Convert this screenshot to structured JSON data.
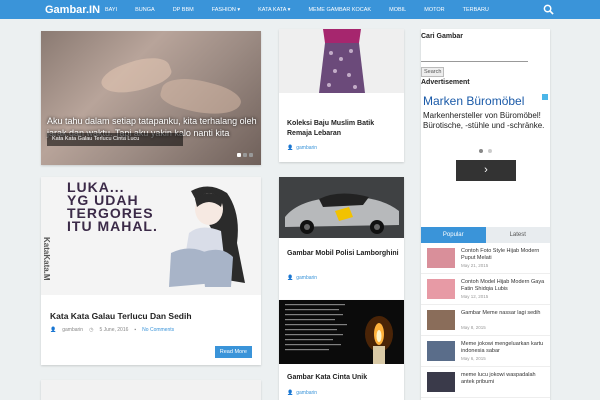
{
  "site": {
    "logo": "Gambar.IN"
  },
  "nav": [
    "BAYI",
    "BUNGA",
    "DP BBM",
    "FASHION ▾",
    "KATA KATA ▾",
    "MEME GAMBAR KOCAK",
    "MOBIL",
    "MOTOR",
    "TERBARU"
  ],
  "slider": {
    "quote": "Aku tahu dalam setiap tatapanku, kita terhalang oleh jarak dan waktu. Tapi aku yakin kalo nanti kita",
    "caption": "Kata Kata Galau Terlucu Cinta Lucu"
  },
  "post1": {
    "image_text": [
      "LUKA...",
      "YG UDAH",
      "TERGORES",
      "ITU MAHAL."
    ],
    "side_text": "KataKata.M",
    "title": "Kata Kata Galau Terlucu Dan Sedih",
    "author": "gambarin",
    "date": "5 June, 2016",
    "comments": "No Comments",
    "read_more": "Read More"
  },
  "mid": [
    {
      "title": "Koleksi Baju Muslim Batik Remaja Lebaran",
      "author": "gambarin"
    },
    {
      "title": "Gambar Mobil Polisi Lamborghini",
      "author": "gambarin"
    },
    {
      "title": "Gambar Kata Cinta Unik",
      "author": "gambarin"
    }
  ],
  "sidebar": {
    "search_heading": "Cari Gambar",
    "search_button": "Search",
    "ad_heading": "Advertisement",
    "ad_brand": "Marken Büromöbel",
    "ad_body": "Markenhersteller von Büromöbel! Bürotische, -stühle und -schränke.",
    "ad_next": "›",
    "tab_popular": "Popular",
    "tab_latest": "Latest",
    "popular": [
      {
        "title": "Contoh Foto Style Hijab Modern Puput Melati",
        "date": "May 21, 2015",
        "color": "#d98f9a"
      },
      {
        "title": "Contoh Model Hijab Modern Gaya Fatin Shidqia Lubis",
        "date": "May 12, 2015",
        "color": "#e79aa5"
      },
      {
        "title": "Gambar Meme nassar lagi sedih",
        "date": "May 8, 2015",
        "color": "#8a6d5a"
      },
      {
        "title": "Meme jokowi mengeluarkan kartu indonesia sabar",
        "date": "May 6, 2015",
        "color": "#5a6d8a"
      },
      {
        "title": "meme lucu jokowi waspadalah antek pribumi",
        "date": "",
        "color": "#3a3a4a"
      }
    ]
  },
  "colors": {
    "primary": "#3a94d9",
    "background": "#ecf0f1"
  }
}
